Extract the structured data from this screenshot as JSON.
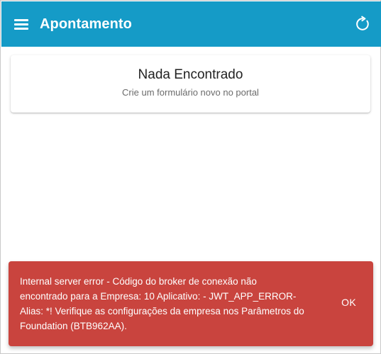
{
  "appbar": {
    "title": "Apontamento",
    "menu_icon": "menu-icon",
    "refresh_icon": "refresh-icon",
    "background": "#159bc7"
  },
  "empty_state": {
    "title": "Nada Encontrado",
    "subtitle": "Crie um formulário novo no portal"
  },
  "snackbar": {
    "message": "Internal server error - Código do broker de conexão não encontrado para a Empresa: 10 Aplicativo: - JWT_APP_ERROR- Alias: *! Verifique as configurações da empresa nos Parâmetros do Foundation (BTB962AA).",
    "action_label": "OK",
    "background": "#c9443e"
  }
}
